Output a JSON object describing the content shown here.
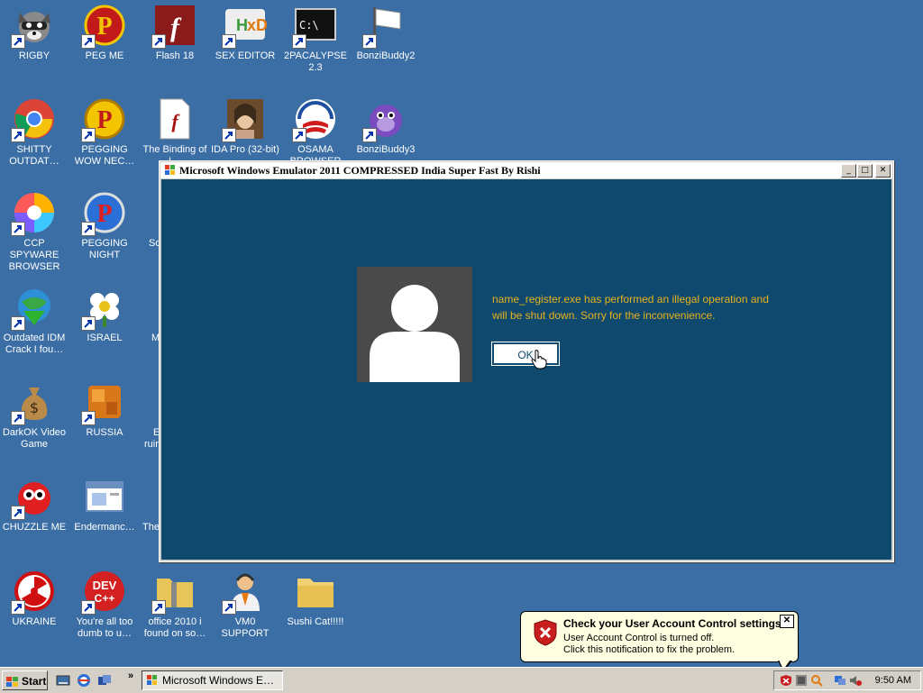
{
  "desktop": {
    "icons": [
      {
        "label": "RIGBY",
        "icon": "raccoon-icon"
      },
      {
        "label": "PEG ME",
        "icon": "peg-p-icon"
      },
      {
        "label": "Flash 18",
        "icon": "flash-icon"
      },
      {
        "label": "SEX EDITOR",
        "icon": "hex-editor-icon"
      },
      {
        "label": "2PACALYPSE 2.3",
        "icon": "terminal-icon"
      },
      {
        "label": "BonziBuddy2",
        "icon": "flag-icon"
      },
      {
        "label": "SHITTY OUTDAT…",
        "icon": "chrome-icon"
      },
      {
        "label": "PEGGING WOW NEC…",
        "icon": "peg-p-gold-icon"
      },
      {
        "label": "The Binding of I…",
        "icon": "flash-document-icon"
      },
      {
        "label": "IDA Pro (32-bit)",
        "icon": "portrait-icon"
      },
      {
        "label": "OSAMA BROWSER",
        "icon": "obama-logo-icon"
      },
      {
        "label": "BonziBuddy3",
        "icon": "purple-gorilla-icon"
      },
      {
        "label": "CCP SPYWARE BROWSER",
        "icon": "pinwheel-icon"
      },
      {
        "label": "PEGGING NIGHT",
        "icon": "peg-p-blue-icon"
      },
      {
        "label": "Outdated IDM Crack I fou…",
        "icon": "idm-globe-icon"
      },
      {
        "label": "ISRAEL",
        "icon": "flower-icon"
      },
      {
        "label": "DarkOK Video Game",
        "icon": "money-bag-icon"
      },
      {
        "label": "RUSSIA",
        "icon": "orange-blocks-icon"
      },
      {
        "label": "CHUZZLE ME",
        "icon": "chuzzle-icon"
      },
      {
        "label": "Endermanc…",
        "icon": "window-app-icon"
      },
      {
        "label": "UKRAINE",
        "icon": "radiation-icon"
      },
      {
        "label": "You're all too dumb to u…",
        "icon": "dev-cpp-icon"
      },
      {
        "label": "office 2010 i found on so…",
        "icon": "zip-folder-icon"
      },
      {
        "label": "VM0 SUPPORT",
        "icon": "support-person-icon"
      },
      {
        "label": "Sushi Cat!!!!!",
        "icon": "folder-icon"
      }
    ],
    "partial_labels": [
      "So",
      "M",
      "E",
      "ruir",
      "The"
    ]
  },
  "window": {
    "title": "Microsoft Windows Emulator 2011 COMPRESSED India Super Fast By Rishi",
    "minimize": "_",
    "maximize": "□",
    "close": "✕",
    "message_line1": "name_register.exe has performed an illegal operation and",
    "message_line2": "will be shut down. Sorry for the inconvenience.",
    "ok_label": "OK"
  },
  "balloon": {
    "title": "Check your User Account Control settings",
    "line1": "User Account Control is turned off.",
    "line2": "Click this notification to fix the problem.",
    "close": "✕"
  },
  "taskbar": {
    "start_label": "Start",
    "chevron": "»",
    "task_button": "Microsoft Windows E…",
    "clock": "9:50 AM"
  },
  "colors": {
    "desktop": "#3a6ea5",
    "client": "#0f4a6e",
    "message": "#e8b21b",
    "balloon": "#ffffe1"
  }
}
